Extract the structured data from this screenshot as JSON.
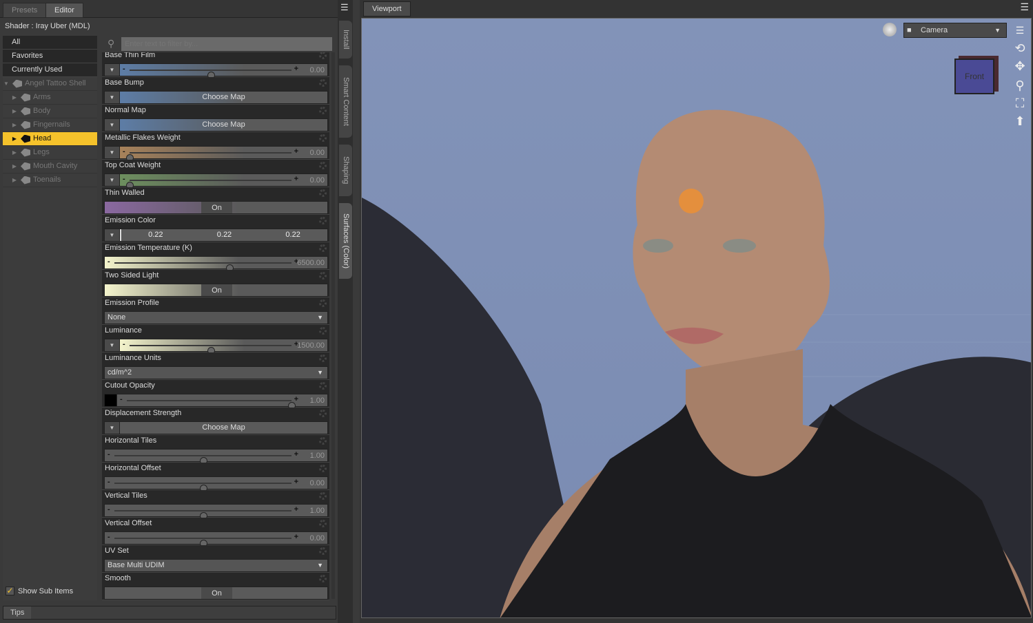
{
  "tabs": {
    "presets": "Presets",
    "editor": "Editor"
  },
  "shader_label": "Shader :  Iray Uber (MDL)",
  "filter_placeholder": "Enter text to filter by...",
  "categories": [
    "All",
    "Favorites",
    "Currently Used"
  ],
  "tree": {
    "root": "Angel Tattoo Shell",
    "children": [
      {
        "label": "Arms",
        "selected": false
      },
      {
        "label": "Body",
        "selected": false
      },
      {
        "label": "Fingernails",
        "selected": false
      },
      {
        "label": "Head",
        "selected": true
      },
      {
        "label": "Legs",
        "selected": false
      },
      {
        "label": "Mouth Cavity",
        "selected": false
      },
      {
        "label": "Toenails",
        "selected": false
      }
    ]
  },
  "show_sub_items": {
    "label": "Show Sub Items",
    "checked": true
  },
  "properties": [
    {
      "label": "Base Thin Film",
      "type": "slider",
      "arrow": true,
      "value": "0.00",
      "fraction": 0.5,
      "color": "#5d7da6"
    },
    {
      "label": "Base Bump",
      "type": "map",
      "value": "Choose Map",
      "color": "#5d7da6"
    },
    {
      "label": "Normal Map",
      "type": "map",
      "value": "Choose Map",
      "color": "#5d7da6"
    },
    {
      "label": "Metallic Flakes Weight",
      "type": "slider",
      "arrow": true,
      "value": "0.00",
      "fraction": 0,
      "color": "#a8825a"
    },
    {
      "label": "Top Coat Weight",
      "type": "slider",
      "arrow": true,
      "value": "0.00",
      "fraction": 0,
      "color": "#6d8f5e"
    },
    {
      "label": "Thin Walled",
      "type": "toggle",
      "value": "On",
      "color": "#8a68a0"
    },
    {
      "label": "Emission Color",
      "type": "color",
      "values": [
        "0.22",
        "0.22",
        "0.22"
      ]
    },
    {
      "label": "Emission Temperature (K)",
      "type": "slider",
      "arrow": false,
      "value": "6500.00",
      "fraction": 0.65,
      "color": "#f4f4cc"
    },
    {
      "label": "Two Sided Light",
      "type": "toggle",
      "value": "On",
      "color": "#f4f4cc"
    },
    {
      "label": "Emission Profile",
      "type": "select",
      "value": "None"
    },
    {
      "label": "Luminance",
      "type": "slider",
      "arrow": true,
      "value": "1500.00",
      "fraction": 0.5,
      "color": "#f4f4cc"
    },
    {
      "label": "Luminance Units",
      "type": "select",
      "value": "cd/m^2"
    },
    {
      "label": "Cutout Opacity",
      "type": "slider",
      "arrow": false,
      "swatch": "#000000",
      "value": "1.00",
      "fraction": 1
    },
    {
      "label": "Displacement Strength",
      "type": "map",
      "value": "Choose Map"
    },
    {
      "label": "Horizontal Tiles",
      "type": "slider",
      "arrow": false,
      "value": "1.00",
      "fraction": 0.5
    },
    {
      "label": "Horizontal Offset",
      "type": "slider",
      "arrow": false,
      "value": "0.00",
      "fraction": 0.5
    },
    {
      "label": "Vertical Tiles",
      "type": "slider",
      "arrow": false,
      "value": "1.00",
      "fraction": 0.5
    },
    {
      "label": "Vertical Offset",
      "type": "slider",
      "arrow": false,
      "value": "0.00",
      "fraction": 0.5
    },
    {
      "label": "UV Set",
      "type": "select",
      "value": "Base Multi UDIM"
    },
    {
      "label": "Smooth",
      "type": "toggle",
      "value": "On"
    }
  ],
  "side_tabs": [
    "Install",
    "Smart Content",
    "Shaping",
    "Surfaces (Color)"
  ],
  "viewport": {
    "tab": "Viewport",
    "camera": "Camera",
    "cube_label": "Front"
  },
  "tips_tab": "Tips"
}
